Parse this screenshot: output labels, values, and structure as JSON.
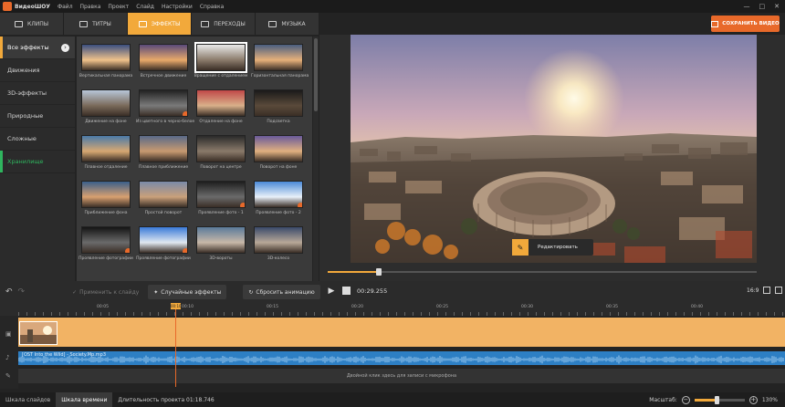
{
  "titlebar": {
    "app_title": "ВидеоШОУ",
    "menu": [
      "Файл",
      "Правка",
      "Проект",
      "Слайд",
      "Настройки",
      "Справка"
    ]
  },
  "tabs": [
    {
      "label": "КЛИПЫ",
      "icon": "film-icon"
    },
    {
      "label": "ТИТРЫ",
      "icon": "text-icon"
    },
    {
      "label": "ЭФФЕКТЫ",
      "icon": "effects-icon"
    },
    {
      "label": "ПЕРЕХОДЫ",
      "icon": "transition-icon"
    },
    {
      "label": "МУЗЫКА",
      "icon": "music-icon"
    }
  ],
  "save_button": "СОХРАНИТЬ ВИДЕО",
  "categories": [
    "Все эффекты",
    "Движения",
    "3D-эффекты",
    "Природные",
    "Сложные",
    "Хранилище"
  ],
  "effects": [
    {
      "label": "Вертикальная панорама"
    },
    {
      "label": "Встречное движение"
    },
    {
      "label": "Вращение с отдалением"
    },
    {
      "label": "Горизонтальная панорама"
    },
    {
      "label": "Движение на фоне"
    },
    {
      "label": "Из цветного в черно-белое"
    },
    {
      "label": "Отдаление на фоне"
    },
    {
      "label": "Подсветка"
    },
    {
      "label": "Плавное отдаление"
    },
    {
      "label": "Плавное приближение"
    },
    {
      "label": "Поворот на центре"
    },
    {
      "label": "Поворот на фоне"
    },
    {
      "label": "Приближение фона"
    },
    {
      "label": "Простой поворот"
    },
    {
      "label": "Проявление фото - 1"
    },
    {
      "label": "Проявление фото - 2"
    },
    {
      "label": "Проявление фотографии"
    },
    {
      "label": "Проявление фотографии"
    },
    {
      "label": "3D-вороты"
    },
    {
      "label": "3D-колесо"
    }
  ],
  "preview": {
    "edit_button": "Редактировать",
    "progress": 0.12
  },
  "toolbar": {
    "apply_to_slide": "Применить к слайду",
    "random_effects": "Случайные эффекты",
    "reset_animation": "Сбросить анимацию",
    "timecode": "00:29.255",
    "aspect_ratio": "16:9"
  },
  "timeline": {
    "ruler_ticks": [
      "00:05",
      "00:10",
      "00:15",
      "00:20",
      "00:25",
      "00:30",
      "00:35",
      "00:40"
    ],
    "audio_label": "[OST Into the Wild] - Society.Mp.mp3",
    "mic_hint": "Двойной клик здесь для записи с микрофона",
    "playhead_label": "00:10"
  },
  "status": {
    "slides_tab": "Шкала слайдов",
    "timeline_tab": "Шкала времени",
    "duration": "Длительность проекта 01:18.746",
    "zoom_label": "Масштаб:",
    "zoom_value": "130%"
  },
  "colors": {
    "accent": "#f2a93b",
    "save": "#e8692a",
    "audio": "#2d7fc4",
    "storage": "#2fb55e"
  }
}
